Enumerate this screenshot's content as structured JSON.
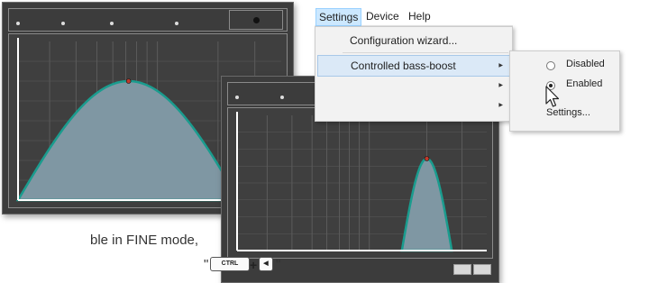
{
  "colors": {
    "window_bg": "#3c3c3c",
    "plot_bg": "#3f3f3f",
    "curve_fill": "#7f97a3",
    "curve_stroke": "#1a9c8e",
    "marker": "#c0392b",
    "menu_highlight": "#cce8ff"
  },
  "menubar": {
    "items": [
      "Settings",
      "Device",
      "Help"
    ]
  },
  "settings_menu": {
    "items": [
      {
        "label": "Configuration wizard...",
        "has_submenu": false
      },
      {
        "label": "Controlled bass-boost",
        "has_submenu": true,
        "highlighted": true
      }
    ]
  },
  "bass_boost_submenu": {
    "options": [
      {
        "label": "Disabled",
        "selected": false
      },
      {
        "label": "Enabled",
        "selected": true
      },
      {
        "label": "Settings...",
        "selected": false
      }
    ]
  },
  "left_window": {
    "chart_data": {
      "type": "area",
      "description": "Broad equalizer curve peaking near the middle of the frequency range",
      "curve_shape": "wide-bell",
      "peak_position": 0.42,
      "peak_level": 0.75,
      "grid": true
    }
  },
  "right_window": {
    "chart_data": {
      "type": "area",
      "description": "Narrow equalizer curve peaking near the high end of the frequency range",
      "curve_shape": "narrow-bell",
      "peak_position": 0.76,
      "peak_level": 0.68,
      "grid": true
    }
  },
  "caption": {
    "line1": "ble in FINE mode,",
    "line2_prefix": "\"",
    "ctrl_key": "CTRL",
    "plus": "+",
    "left_arrow_key": "◀",
    "line2_suffix": "\""
  }
}
